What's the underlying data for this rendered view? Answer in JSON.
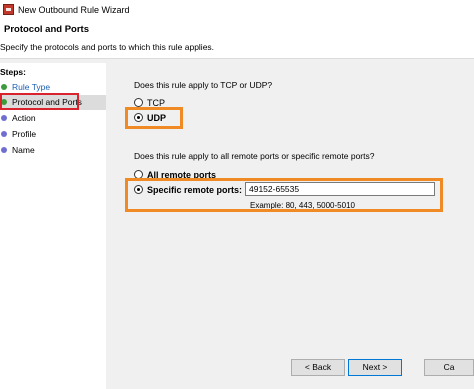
{
  "window": {
    "title": "New Outbound Rule Wizard"
  },
  "header": {
    "title": "Protocol and Ports",
    "subtitle": "Specify the protocols and ports to which this rule applies."
  },
  "steps": {
    "label": "Steps:",
    "items": [
      {
        "label": "Rule Type",
        "color": "#3c9b3c",
        "state": "done"
      },
      {
        "label": "Protocol and Ports",
        "color": "#3c9b3c",
        "state": "current"
      },
      {
        "label": "Action",
        "color": "#6f6fd0",
        "state": "pending"
      },
      {
        "label": "Profile",
        "color": "#6f6fd0",
        "state": "pending"
      },
      {
        "label": "Name",
        "color": "#6f6fd0",
        "state": "pending"
      }
    ]
  },
  "protocol": {
    "question": "Does this rule apply to TCP or UDP?",
    "options": [
      {
        "label": "TCP",
        "checked": false
      },
      {
        "label": "UDP",
        "checked": true
      }
    ]
  },
  "ports": {
    "question": "Does this rule apply to all remote ports or specific remote ports?",
    "options": [
      {
        "label": "All remote ports",
        "checked": false
      },
      {
        "label": "Specific remote ports:",
        "checked": true
      }
    ],
    "value": "49152-65535",
    "example": "Example: 80, 443, 5000-5010"
  },
  "buttons": {
    "back": "< Back",
    "next": "Next >",
    "cancel": "Ca"
  },
  "colors": {
    "highlight_red": "#d9232e",
    "highlight_orange": "#f08a24",
    "step_done": "#3c9b3c",
    "step_pending": "#6f6fd0"
  }
}
